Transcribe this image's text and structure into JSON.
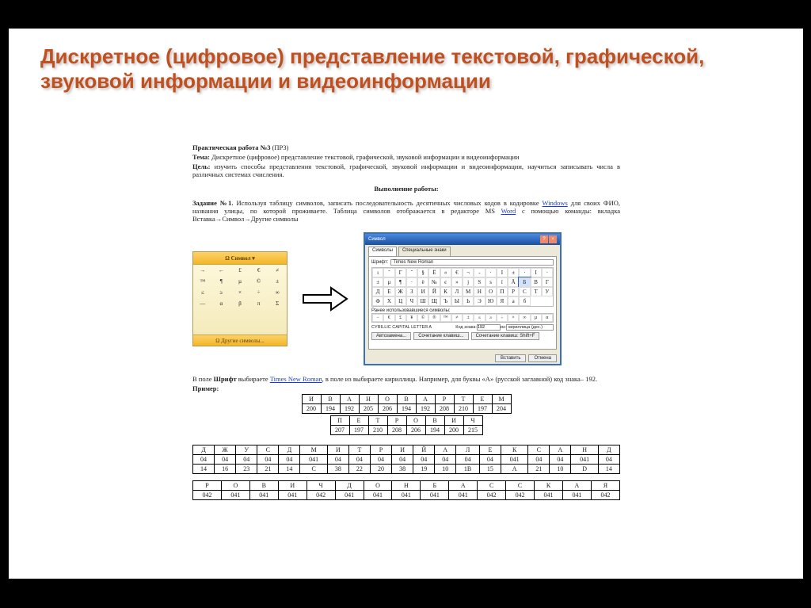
{
  "title_line1": "Дискретное (цифровое) представление текстовой, графической,",
  "title_line2": "звуковой информации и видеоинформации",
  "doc": {
    "heading": "Практическая работа №3",
    "heading_suffix": "(ПР3)",
    "tema_label": "Тема:",
    "tema": "Дискретное (цифровое) представление текстовой, графической, звуковой информации и видеоинформации",
    "cel_label": "Цель:",
    "cel": "изучить способы представления текстовой, графической, звуковой информации и видеоинформации, научиться записывать числа в различных системах счисления.",
    "section": "Выполнение работы:",
    "task1_label": "Задание №1.",
    "task1_a": "Используя таблицу символов, записать последовательность десятичных числовых кодов в кодировке ",
    "task1_link1": "Windows",
    "task1_b": " для своих ФИО, названия улицы, по которой проживаете. Таблица символов отображается в редакторе MS ",
    "task1_link2": "Word",
    "task1_c": " с помощью команды: вкладка Вставка→Символ→Другие символы",
    "small_menu_top": "Ω Символ ▾",
    "small_menu_grid": [
      "→",
      "←",
      "£",
      "€",
      "≠",
      "™",
      "¶",
      "µ",
      "©",
      "±",
      "≤",
      "≥",
      "×",
      "÷",
      "∞",
      "—",
      "α",
      "β",
      "π",
      "Σ"
    ],
    "small_menu_bot": "Ω Другие символы...",
    "dialog": {
      "title": "Символ",
      "tab1": "Символы",
      "tab2": "Специальные знаки",
      "font_label": "Шрифт:",
      "font_value": "Times New Roman",
      "chars": [
        "ı",
        "ˇ",
        "Γ",
        "˘",
        "§",
        "Ё",
        "«",
        "€",
        "¬",
        "-",
        "·",
        "І",
        "±",
        "·",
        "І",
        "·",
        "±",
        "µ",
        "¶",
        "·",
        "ё",
        "№",
        "є",
        "»",
        "ј",
        "Ѕ",
        "ѕ",
        "ї",
        "Ā",
        "Б",
        "В",
        "Г",
        "Д",
        "Е",
        "Ж",
        "З",
        "И",
        "Й",
        "К",
        "Л",
        "М",
        "Н",
        "О",
        "П",
        "Р",
        "С",
        "Т",
        "У",
        "Ф",
        "Х",
        "Ц",
        "Ч",
        "Ш",
        "Щ",
        "Ъ",
        "Ы",
        "Ь",
        "Э",
        "Ю",
        "Я",
        "а",
        "б"
      ],
      "highlight_index": 29,
      "recent_label": "Ранее использовавшиеся символы:",
      "recent": [
        "−",
        "€",
        "£",
        "¥",
        "©",
        "®",
        "™",
        "≠",
        "±",
        "≤",
        "≥",
        "÷",
        "×",
        "∞",
        "µ",
        "α"
      ],
      "charname": "CYRILLIC CAPITAL LETTER A",
      "code_label": "Код знака:",
      "code": "192",
      "from_label": "из:",
      "from": "кириллица (дес.)",
      "btn_auto": "Автозамена...",
      "btn_short": "Сочетание клавиш...",
      "short_text": "Сочетание клавиш: Shift+F",
      "btn_insert": "Вставить",
      "btn_cancel": "Отмена"
    },
    "para2_a": "В поле ",
    "para2_b": "Шрифт",
    "para2_c": " выбираете ",
    "para2_link": "Times New Roman",
    "para2_d": ", в поле из выбираете кириллица. Например, для буквы «А» (русской заглавной) код знака– 192.",
    "example_label": "Пример:",
    "table1": {
      "letters": [
        "И",
        "В",
        "А",
        "Н",
        "О",
        "В",
        "А",
        "Р",
        "Т",
        "Е",
        "М"
      ],
      "codes": [
        "200",
        "194",
        "192",
        "205",
        "206",
        "194",
        "192",
        "208",
        "210",
        "197",
        "204"
      ]
    },
    "table2": {
      "letters": [
        "П",
        "Е",
        "Т",
        "Р",
        "О",
        "В",
        "И",
        "Ч"
      ],
      "codes": [
        "207",
        "197",
        "210",
        "208",
        "206",
        "194",
        "200",
        "215"
      ]
    },
    "table3": {
      "letters": [
        "Д",
        "Ж",
        "У",
        "С",
        "Д",
        "М",
        "И",
        "Т",
        "Р",
        "И",
        "Й",
        "А",
        "Л",
        "Е",
        "К",
        "С",
        "А",
        "Н",
        "Д"
      ],
      "codes1": [
        "04",
        "04",
        "04",
        "04",
        "04",
        "041",
        "04",
        "04",
        "04",
        "04",
        "04",
        "04",
        "04",
        "04",
        "041",
        "04",
        "04",
        "041",
        "04"
      ],
      "codes2": [
        "14",
        "16",
        "23",
        "21",
        "14",
        "C",
        "38",
        "22",
        "20",
        "38",
        "19",
        "10",
        "1B",
        "15",
        "A",
        "21",
        "10",
        "D",
        "14"
      ]
    },
    "table4": {
      "letters": [
        "Р",
        "О",
        "В",
        "И",
        "Ч",
        "Д",
        "О",
        "Н",
        "Б",
        "А",
        "С",
        "С",
        "К",
        "А",
        "Я"
      ],
      "codes1": [
        "042",
        "041",
        "041",
        "041",
        "042",
        "041",
        "041",
        "041",
        "041",
        "041",
        "042",
        "042",
        "041",
        "041",
        "042"
      ]
    }
  }
}
